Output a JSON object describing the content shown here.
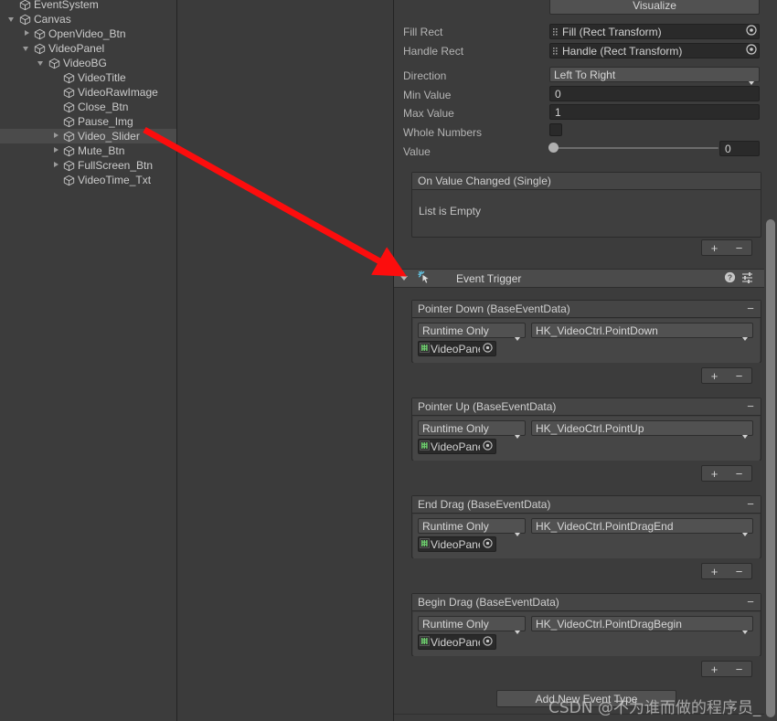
{
  "hierarchy": {
    "items": [
      {
        "label": "EventSystem",
        "indent": 0,
        "twisty": "none",
        "selected": false,
        "clipped": true
      },
      {
        "label": "Canvas",
        "indent": 0,
        "twisty": "open",
        "selected": false
      },
      {
        "label": "OpenVideo_Btn",
        "indent": 1,
        "twisty": "closed",
        "selected": false
      },
      {
        "label": "VideoPanel",
        "indent": 1,
        "twisty": "open",
        "selected": false
      },
      {
        "label": "VideoBG",
        "indent": 2,
        "twisty": "open",
        "selected": false
      },
      {
        "label": "VideoTitle",
        "indent": 3,
        "twisty": "none",
        "selected": false
      },
      {
        "label": "VideoRawImage",
        "indent": 3,
        "twisty": "none",
        "selected": false
      },
      {
        "label": "Close_Btn",
        "indent": 3,
        "twisty": "none",
        "selected": false
      },
      {
        "label": "Pause_Img",
        "indent": 3,
        "twisty": "none",
        "selected": false
      },
      {
        "label": "Video_Slider",
        "indent": 3,
        "twisty": "closed",
        "selected": true
      },
      {
        "label": "Mute_Btn",
        "indent": 3,
        "twisty": "closed",
        "selected": false
      },
      {
        "label": "FullScreen_Btn",
        "indent": 3,
        "twisty": "closed",
        "selected": false
      },
      {
        "label": "VideoTime_Txt",
        "indent": 3,
        "twisty": "none",
        "selected": false
      }
    ]
  },
  "inspector": {
    "visualize_button": "Visualize",
    "slider": {
      "fill_rect_label": "Fill Rect",
      "fill_rect_value": "Fill (Rect Transform)",
      "handle_rect_label": "Handle Rect",
      "handle_rect_value": "Handle (Rect Transform)",
      "direction_label": "Direction",
      "direction_value": "Left To Right",
      "min_value_label": "Min Value",
      "min_value": "0",
      "max_value_label": "Max Value",
      "max_value": "1",
      "whole_numbers_label": "Whole Numbers",
      "whole_numbers_checked": false,
      "value_label": "Value",
      "value": "0",
      "value_slider_percent": 0
    },
    "on_value_changed": {
      "title": "On Value Changed (Single)",
      "empty_text": "List is Empty",
      "add_label": "+",
      "remove_label": "−"
    },
    "event_trigger": {
      "title": "Event Trigger",
      "help_icon": "help-icon",
      "preset_icon": "preset-icon",
      "menu_icon": "kebab-menu-icon",
      "entries": [
        {
          "title": "Pointer Down (BaseEventData)",
          "runtime_mode": "Runtime Only",
          "function": "HK_VideoCtrl.PointDown",
          "target_object": "VideoPanel (H"
        },
        {
          "title": "Pointer Up (BaseEventData)",
          "runtime_mode": "Runtime Only",
          "function": "HK_VideoCtrl.PointUp",
          "target_object": "VideoPanel (H"
        },
        {
          "title": "End Drag (BaseEventData)",
          "runtime_mode": "Runtime Only",
          "function": "HK_VideoCtrl.PointDragEnd",
          "target_object": "VideoPanel (H"
        },
        {
          "title": "Begin Drag (BaseEventData)",
          "runtime_mode": "Runtime Only",
          "function": "HK_VideoCtrl.PointDragBegin",
          "target_object": "VideoPanel (H"
        }
      ],
      "add_label": "+",
      "remove_label": "−",
      "minus_label": "−",
      "add_new_event_type_button": "Add New Event Type"
    }
  },
  "annotation": {
    "arrow_color": "#fc0d0d",
    "arrow_from_label": "Video_Slider",
    "arrow_to_label": "Event Trigger"
  },
  "watermark": "CSDN @不为谁而做的程序员_"
}
